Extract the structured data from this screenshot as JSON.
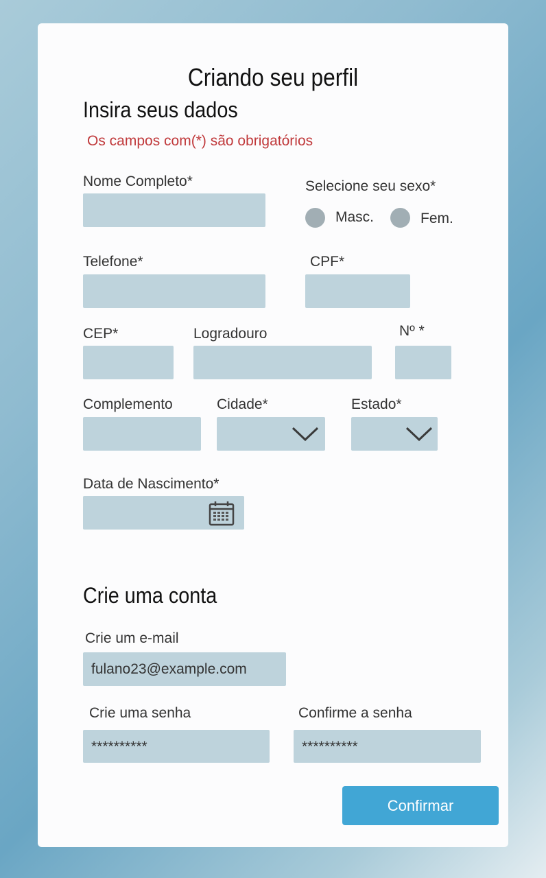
{
  "header": {
    "title": "Criando seu perfil"
  },
  "personal": {
    "section_title": "Insira seus dados",
    "required_note": "Os campos com(*) são obrigatórios",
    "full_name_label": "Nome Completo*",
    "sex_label": "Selecione seu sexo*",
    "sex_options": [
      "Masc.",
      "Fem."
    ],
    "phone_label": "Telefone*",
    "cpf_label": "CPF*",
    "cep_label": "CEP*",
    "street_label": "Logradouro",
    "number_label": "Nº *",
    "complement_label": "Complemento",
    "city_label": "Cidade*",
    "state_label": "Estado*",
    "birth_label": "Data de Nascimento*"
  },
  "account": {
    "section_title": "Crie uma conta",
    "email_label": "Crie um e-mail",
    "email_value": "fulano23@example.com",
    "password_label": "Crie uma senha",
    "password_value": "**********",
    "confirm_label": "Confirme a senha",
    "confirm_value": "**********"
  },
  "actions": {
    "confirm_label": "Confirmar"
  },
  "icons": {
    "dropdown": "chevron-down-icon",
    "date": "calendar-icon"
  },
  "colors": {
    "field_bg": "#bed3dc",
    "button_bg": "#41a6d5",
    "required_text": "#c0393b",
    "radio": "#a1aeb4"
  }
}
